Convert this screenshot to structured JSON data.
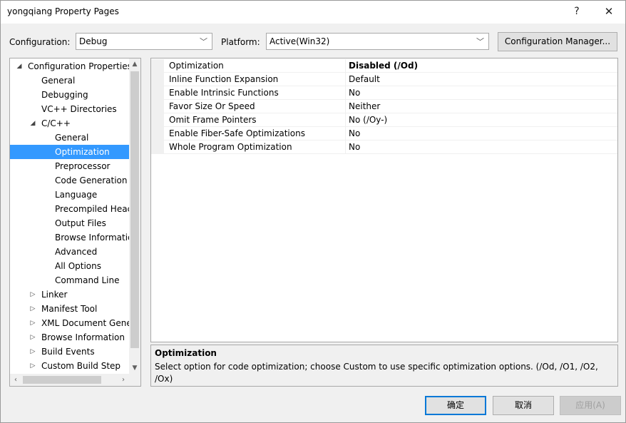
{
  "window": {
    "title": "yongqiang Property Pages",
    "help_glyph": "?",
    "close_glyph": "✕"
  },
  "config": {
    "configuration_label": "Configuration:",
    "configuration_value": "Debug",
    "platform_label": "Platform:",
    "platform_value": "Active(Win32)",
    "manager_label": "Configuration Manager..."
  },
  "tree": {
    "items": [
      {
        "label": "Configuration Properties",
        "expander": "◢"
      },
      {
        "label": "General",
        "expander": ""
      },
      {
        "label": "Debugging",
        "expander": ""
      },
      {
        "label": "VC++ Directories",
        "expander": ""
      },
      {
        "label": "C/C++",
        "expander": "◢"
      },
      {
        "label": "General",
        "expander": ""
      },
      {
        "label": "Optimization",
        "expander": ""
      },
      {
        "label": "Preprocessor",
        "expander": ""
      },
      {
        "label": "Code Generation",
        "expander": ""
      },
      {
        "label": "Language",
        "expander": ""
      },
      {
        "label": "Precompiled Heac",
        "expander": ""
      },
      {
        "label": "Output Files",
        "expander": ""
      },
      {
        "label": "Browse Informatic",
        "expander": ""
      },
      {
        "label": "Advanced",
        "expander": ""
      },
      {
        "label": "All Options",
        "expander": ""
      },
      {
        "label": "Command Line",
        "expander": ""
      },
      {
        "label": "Linker",
        "expander": "▷"
      },
      {
        "label": "Manifest Tool",
        "expander": "▷"
      },
      {
        "label": "XML Document Gene",
        "expander": "▷"
      },
      {
        "label": "Browse Information",
        "expander": "▷"
      },
      {
        "label": "Build Events",
        "expander": "▷"
      },
      {
        "label": "Custom Build Step",
        "expander": "▷"
      }
    ],
    "selected": "Optimization"
  },
  "grid": {
    "rows": [
      {
        "name": "Optimization",
        "value": "Disabled (/Od)"
      },
      {
        "name": "Inline Function Expansion",
        "value": "Default"
      },
      {
        "name": "Enable Intrinsic Functions",
        "value": "No"
      },
      {
        "name": "Favor Size Or Speed",
        "value": "Neither"
      },
      {
        "name": "Omit Frame Pointers",
        "value": "No (/Oy-)"
      },
      {
        "name": "Enable Fiber-Safe Optimizations",
        "value": "No"
      },
      {
        "name": "Whole Program Optimization",
        "value": "No"
      }
    ]
  },
  "description": {
    "title": "Optimization",
    "text": "Select option for code optimization; choose Custom to use specific optimization options.     (/Od, /O1, /O2, /Ox)"
  },
  "buttons": {
    "ok": "确定",
    "cancel": "取消",
    "apply": "应用(A)"
  },
  "colors": {
    "selection": "#3399ff",
    "default_button_border": "#0078d7"
  }
}
